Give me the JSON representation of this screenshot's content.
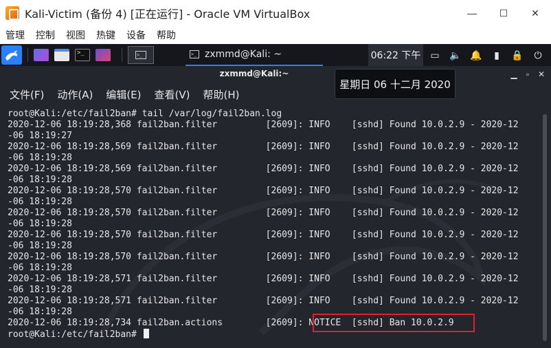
{
  "window": {
    "title": "Kali-Victim (备份 4) [正在运行] - Oracle VM VirtualBox",
    "controls": {
      "minimize": "—",
      "maximize": "☐",
      "close": "✕"
    }
  },
  "vbox_menu": [
    "管理",
    "控制",
    "视图",
    "热键",
    "设备",
    "帮助"
  ],
  "panel": {
    "task_label": "zxmmd@Kali: ~",
    "clock": "06:22 下午",
    "tray": {
      "display": "▭",
      "volume": "🔈",
      "bell": "🔔",
      "battery": "▮",
      "lock": "🔒",
      "power": "⏻"
    }
  },
  "terminal": {
    "title": "zxmmd@Kali:~",
    "controls": {
      "minimize": "▁",
      "maximize": "▫",
      "close": "✕"
    },
    "menu": [
      "文件(F)",
      "动作(A)",
      "编辑(E)",
      "查看(V)",
      "帮助(H)"
    ],
    "lines": [
      "root@Kali:/etc/fail2ban# tail /var/log/fail2ban.log",
      "2020-12-06 18:19:28,368 fail2ban.filter         [2609]: INFO    [sshd] Found 10.0.2.9 - 2020-12",
      "-06 18:19:27",
      "2020-12-06 18:19:28,569 fail2ban.filter         [2609]: INFO    [sshd] Found 10.0.2.9 - 2020-12",
      "-06 18:19:28",
      "2020-12-06 18:19:28,569 fail2ban.filter         [2609]: INFO    [sshd] Found 10.0.2.9 - 2020-12",
      "-06 18:19:28",
      "2020-12-06 18:19:28,570 fail2ban.filter         [2609]: INFO    [sshd] Found 10.0.2.9 - 2020-12",
      "-06 18:19:28",
      "2020-12-06 18:19:28,570 fail2ban.filter         [2609]: INFO    [sshd] Found 10.0.2.9 - 2020-12",
      "-06 18:19:28",
      "2020-12-06 18:19:28,570 fail2ban.filter         [2609]: INFO    [sshd] Found 10.0.2.9 - 2020-12",
      "-06 18:19:28",
      "2020-12-06 18:19:28,570 fail2ban.filter         [2609]: INFO    [sshd] Found 10.0.2.9 - 2020-12",
      "-06 18:19:28",
      "2020-12-06 18:19:28,571 fail2ban.filter         [2609]: INFO    [sshd] Found 10.0.2.9 - 2020-12",
      "-06 18:19:28",
      "2020-12-06 18:19:28,571 fail2ban.filter         [2609]: INFO    [sshd] Found 10.0.2.9 - 2020-12",
      "-06 18:19:28",
      "2020-12-06 18:19:28,734 fail2ban.actions        [2609]: NOTICE  [sshd] Ban 10.0.2.9"
    ],
    "prompt": "root@Kali:/etc/fail2ban# "
  },
  "tooltip": "星期日 06 十二月 2020",
  "colors": {
    "panel_accent": "#2a7fff",
    "highlight": "#e0202a",
    "terminal_bg": "#23262d"
  }
}
